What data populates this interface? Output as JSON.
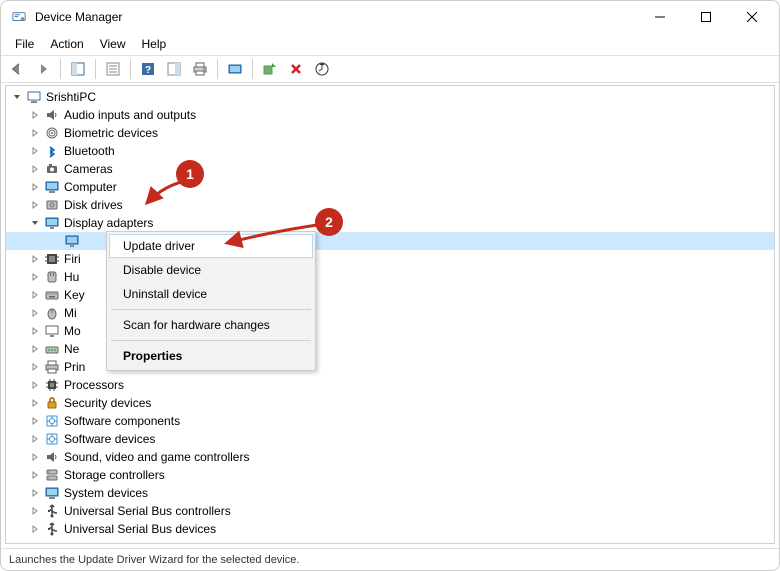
{
  "window": {
    "title": "Device Manager"
  },
  "menu": {
    "file": "File",
    "action": "Action",
    "view": "View",
    "help": "Help"
  },
  "tree": {
    "root": "SrishtiPC",
    "items": [
      {
        "label": "Audio inputs and outputs",
        "icon": "speaker"
      },
      {
        "label": "Biometric devices",
        "icon": "fingerprint"
      },
      {
        "label": "Bluetooth",
        "icon": "bluetooth"
      },
      {
        "label": "Cameras",
        "icon": "camera"
      },
      {
        "label": "Computer",
        "icon": "computer"
      },
      {
        "label": "Disk drives",
        "icon": "disk"
      },
      {
        "label": "Display adapters",
        "icon": "display",
        "expanded": true
      },
      {
        "label": "Firi",
        "icon": "firmware"
      },
      {
        "label": "Hu",
        "icon": "hid"
      },
      {
        "label": "Key",
        "icon": "keyboard"
      },
      {
        "label": "Mi",
        "icon": "mouse"
      },
      {
        "label": "Mo",
        "icon": "monitor"
      },
      {
        "label": "Ne",
        "icon": "network"
      },
      {
        "label": "Prin",
        "icon": "printqueue"
      },
      {
        "label": "Processors",
        "icon": "cpu"
      },
      {
        "label": "Security devices",
        "icon": "security"
      },
      {
        "label": "Software components",
        "icon": "software"
      },
      {
        "label": "Software devices",
        "icon": "software"
      },
      {
        "label": "Sound, video and game controllers",
        "icon": "speaker"
      },
      {
        "label": "Storage controllers",
        "icon": "storage"
      },
      {
        "label": "System devices",
        "icon": "system"
      },
      {
        "label": "Universal Serial Bus controllers",
        "icon": "usb"
      },
      {
        "label": "Universal Serial Bus devices",
        "icon": "usb"
      }
    ],
    "display_child_label": ""
  },
  "context_menu": {
    "update": "Update driver",
    "disable": "Disable device",
    "uninstall": "Uninstall device",
    "scan": "Scan for hardware changes",
    "properties": "Properties"
  },
  "statusbar": {
    "text": "Launches the Update Driver Wizard for the selected device."
  },
  "annotations": {
    "badges": [
      "1",
      "2"
    ]
  }
}
